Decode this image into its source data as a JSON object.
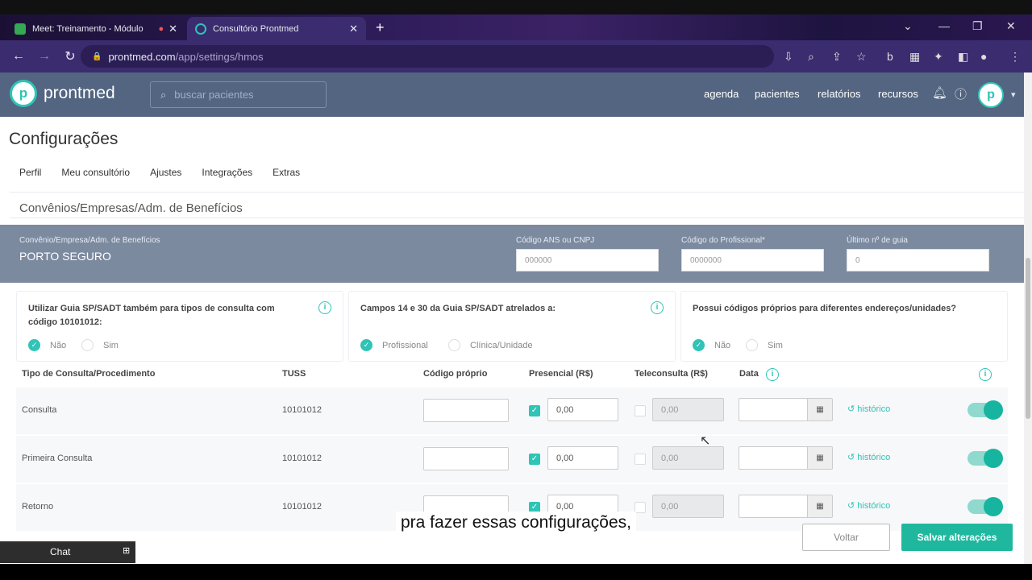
{
  "browser": {
    "tabs": [
      {
        "title": "Meet: Treinamento - Módulo",
        "favicon_color": "#34a853"
      },
      {
        "title": "Consultório Prontmed",
        "favicon_color": "#2ec4b6"
      }
    ],
    "new_tab": "+",
    "url_host": "prontmed.com",
    "url_path": "/app/settings/hmos"
  },
  "header": {
    "logo_text": "prontmed",
    "search_placeholder": "buscar pacientes",
    "nav": [
      "agenda",
      "pacientes",
      "relatórios",
      "recursos"
    ]
  },
  "page": {
    "title": "Configurações",
    "tabs": [
      "Perfil",
      "Meu consultório",
      "Ajustes",
      "Integrações",
      "Extras"
    ],
    "section_title": "Convênios/Empresas/Adm. de Benefícios"
  },
  "insurer": {
    "label": "Convênio/Empresa/Adm. de Benefícios",
    "value": "PORTO SEGURO",
    "ans_label": "Código ANS ou CNPJ",
    "ans_value": "000000",
    "prof_label": "Código do Profissional*",
    "prof_value": "0000000",
    "guia_label": "Último nº de guia",
    "guia_value": "0"
  },
  "cards": [
    {
      "text": "Utilizar Guia SP/SADT também para tipos de consulta com código 10101012:",
      "opt_on": "Não",
      "opt_off": "Sim"
    },
    {
      "text": "Campos 14 e 30 da Guia SP/SADT atrelados a:",
      "opt_on": "Profissional",
      "opt_off": "Clínica/Unidade"
    },
    {
      "text": "Possui códigos próprios para diferentes endereços/unidades?",
      "opt_on": "Não",
      "opt_off": "Sim"
    }
  ],
  "table": {
    "headers": [
      "Tipo de Consulta/Procedimento",
      "TUSS",
      "Código próprio",
      "Presencial (R$)",
      "Teleconsulta (R$)",
      "Data"
    ],
    "rows": [
      {
        "name": "Consulta",
        "tuss": "10101012",
        "presencial": "0,00",
        "tele": "0,00",
        "hist": "histórico"
      },
      {
        "name": "Primeira Consulta",
        "tuss": "10101012",
        "presencial": "0,00",
        "tele": "0,00",
        "hist": "histórico"
      },
      {
        "name": "Retorno",
        "tuss": "10101012",
        "presencial": "0,00",
        "tele": "0,00",
        "hist": "histórico"
      }
    ]
  },
  "buttons": {
    "back": "Voltar",
    "save": "Salvar alterações"
  },
  "chat": {
    "label": "Chat"
  },
  "subtitle": "pra fazer essas configurações,"
}
